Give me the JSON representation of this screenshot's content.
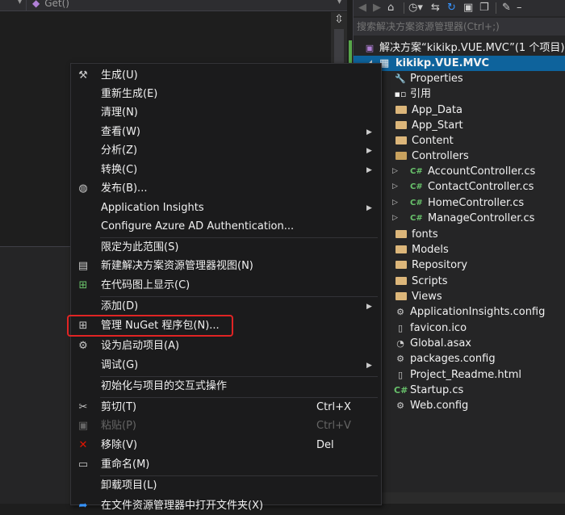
{
  "editor": {
    "nav_method": "Get()",
    "split_glyph": "⇳"
  },
  "toolbar": {
    "icons": [
      "back-icon",
      "forward-icon",
      "home-icon",
      "history-icon",
      "sync-icon",
      "refresh-icon",
      "collapse-icon",
      "copy-icon",
      "properties-icon"
    ]
  },
  "search": {
    "placeholder": "搜索解决方案资源管理器(Ctrl+;)"
  },
  "tree": {
    "solution": "解决方案“kikikp.VUE.MVC”(1 个项目)",
    "project": "kikikp.VUE.MVC",
    "items": [
      {
        "label": "Properties",
        "icon": "wrench-icon"
      },
      {
        "label": "引用",
        "icon": "references-icon"
      },
      {
        "label": "App_Data",
        "icon": "folder-icon"
      },
      {
        "label": "App_Start",
        "icon": "folder-icon"
      },
      {
        "label": "Content",
        "icon": "folder-icon"
      },
      {
        "label": "Controllers",
        "icon": "folder-open-icon"
      },
      {
        "label": "AccountController.cs",
        "icon": "csharp-file-icon"
      },
      {
        "label": "ContactController.cs",
        "icon": "csharp-file-icon"
      },
      {
        "label": "HomeController.cs",
        "icon": "csharp-file-icon"
      },
      {
        "label": "ManageController.cs",
        "icon": "csharp-file-icon"
      },
      {
        "label": "fonts",
        "icon": "folder-icon"
      },
      {
        "label": "Models",
        "icon": "folder-icon"
      },
      {
        "label": "Repository",
        "icon": "folder-icon"
      },
      {
        "label": "Scripts",
        "icon": "folder-icon"
      },
      {
        "label": "Views",
        "icon": "folder-icon"
      },
      {
        "label": "ApplicationInsights.config",
        "icon": "config-file-icon"
      },
      {
        "label": "favicon.ico",
        "icon": "ico-file-icon"
      },
      {
        "label": "Global.asax",
        "icon": "asax-file-icon"
      },
      {
        "label": "packages.config",
        "icon": "config-file-icon"
      },
      {
        "label": "Project_Readme.html",
        "icon": "html-file-icon"
      },
      {
        "label": "Startup.cs",
        "icon": "csharp-file-icon"
      },
      {
        "label": "Web.config",
        "icon": "config-file-icon"
      }
    ]
  },
  "menu": {
    "build": "生成(U)",
    "rebuild": "重新生成(E)",
    "clean": "清理(N)",
    "view": "查看(W)",
    "analyze": "分析(Z)",
    "convert": "转换(C)",
    "publish": "发布(B)...",
    "app_insights": "Application Insights",
    "azure_ad": "Configure Azure AD Authentication...",
    "scope": "限定为此范围(S)",
    "new_view": "新建解决方案资源管理器视图(N)",
    "code_map": "在代码图上显示(C)",
    "add": "添加(D)",
    "nuget": "管理 NuGet 程序包(N)...",
    "startup": "设为启动项目(A)",
    "debug": "调试(G)",
    "interactive": "初始化与项目的交互式操作",
    "cut": "剪切(T)",
    "cut_shortcut": "Ctrl+X",
    "paste": "粘贴(P)",
    "paste_shortcut": "Ctrl+V",
    "remove": "移除(V)",
    "remove_shortcut": "Del",
    "rename": "重命名(M)",
    "unload": "卸载项目(L)",
    "partial": "在文件资源管理器中打开文件夹(X)"
  },
  "colors": {
    "highlight_box": "#e02424",
    "selection": "#0e639c",
    "folder": "#dcb67a",
    "csharp": "#68c16b"
  }
}
